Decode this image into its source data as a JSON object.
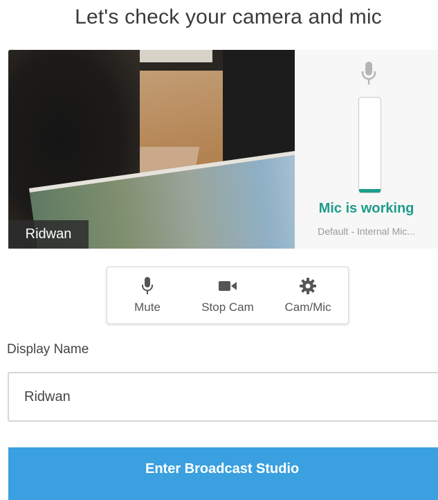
{
  "page": {
    "title": "Let's check your camera and mic"
  },
  "camera": {
    "name_tag": "Ridwan"
  },
  "mic": {
    "status": "Mic is working",
    "device": "Default - Internal Mic...",
    "level": 0.04,
    "status_color": "#1e9c8a",
    "icon": "microphone-icon"
  },
  "controls": [
    {
      "label": "Mute",
      "icon": "microphone-icon"
    },
    {
      "label": "Stop Cam",
      "icon": "video-camera-icon"
    },
    {
      "label": "Cam/Mic",
      "icon": "gear-icon"
    }
  ],
  "display_name": {
    "label": "Display Name",
    "value": "Ridwan"
  },
  "enter_button": {
    "label": "Enter Broadcast Studio",
    "color": "#3aa0df"
  }
}
